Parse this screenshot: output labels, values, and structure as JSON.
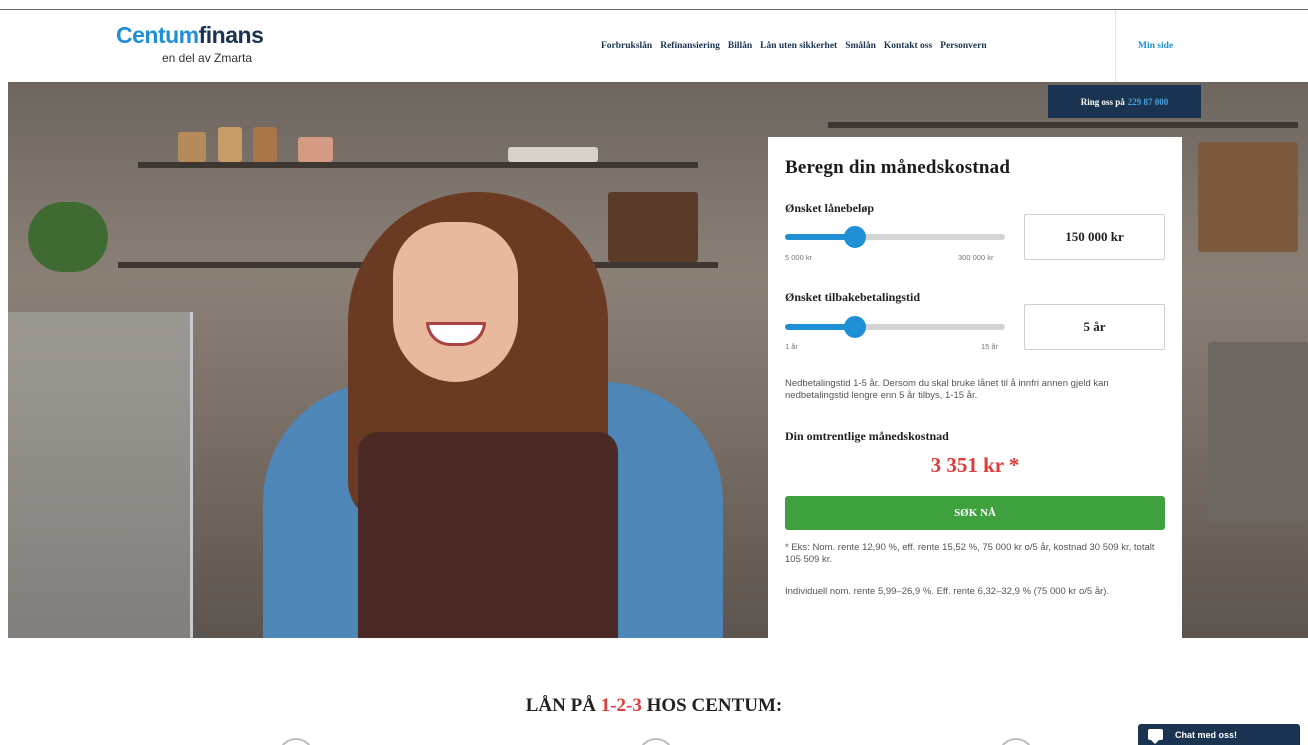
{
  "header": {
    "logo_main_a": "Centum",
    "logo_main_b": "finans",
    "logo_sub": "en del av Zmarta",
    "nav": [
      "Forbrukslån",
      "Refinansiering",
      "Billån",
      "Lån uten sikkerhet",
      "Smålån",
      "Kontakt oss",
      "Personvern"
    ],
    "min_side": "Min side"
  },
  "callbar": {
    "label": "Ring oss på",
    "number": "229 87 000"
  },
  "calculator": {
    "title": "Beregn din månedskostnad",
    "loan": {
      "label": "Ønsket lånebeløp",
      "value": "150 000 kr",
      "min": "5 000 kr",
      "max": "300 000 kr",
      "fill_fraction": 0.32
    },
    "term": {
      "label": "Ønsket tilbakebetalingstid",
      "value": "5 år",
      "min": "1 år",
      "max": "15 år",
      "fill_fraction": 0.32
    },
    "term_note": "Nedbetalingstid 1-5 år. Dersom du skal bruke lånet til å innfri annen gjeld kan nedbetalingstid lengre enn 5 år tilbys, 1-15 år.",
    "result_label": "Din omtrentlige månedskostnad",
    "result_value": "3 351 kr *",
    "apply_label": "SØK NÅ",
    "example": "* Eks: Nom. rente 12,90 %, eff. rente 15,52 %, 75 000 kr o/5 år, kostnad 30 509 kr, totalt 105 509 kr.",
    "individual": "Individuell nom. rente 5,99–26,9 %. Eff. rente 6,32–32,9 % (75 000 kr o/5 år)."
  },
  "steps": {
    "title_a": "LÅN PÅ ",
    "title_accent": "1-2-3",
    "title_b": " HOS CENTUM:"
  },
  "chat": {
    "label": "Chat med oss!",
    "icon": "chat-bubble-icon"
  },
  "colors": {
    "brand_blue": "#1f8fd6",
    "navy": "#1a3350",
    "cta_green": "#3ea13e",
    "accent_red": "#e23b3b"
  }
}
